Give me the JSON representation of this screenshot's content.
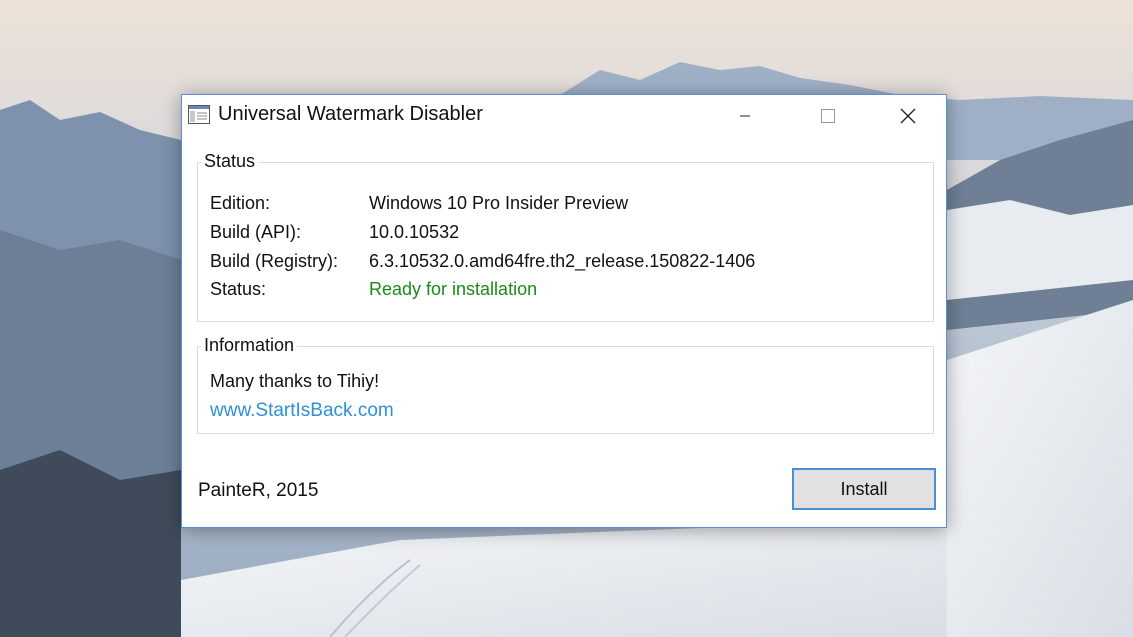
{
  "window": {
    "title": "Universal Watermark Disabler"
  },
  "status_group": {
    "legend": "Status",
    "rows": [
      {
        "label": "Edition:",
        "value": "Windows 10 Pro Insider Preview"
      },
      {
        "label": "Build (API):",
        "value": "10.0.10532"
      },
      {
        "label": "Build (Registry):",
        "value": "6.3.10532.0.amd64fre.th2_release.150822-1406"
      },
      {
        "label": "Status:",
        "value": "Ready for installation"
      }
    ]
  },
  "info_group": {
    "legend": "Information",
    "text": "Many thanks to Tihiy!",
    "link": "www.StartIsBack.com"
  },
  "footer": {
    "author": "PainteR, 2015",
    "install_label": "Install"
  },
  "colors": {
    "status_ok": "#1a8a1a",
    "link": "#2f8fd8",
    "window_border": "#5b8fd1"
  },
  "icons": {
    "app": "window-app-icon",
    "minimize": "minimize-icon",
    "maximize": "maximize-icon",
    "close": "close-icon"
  }
}
